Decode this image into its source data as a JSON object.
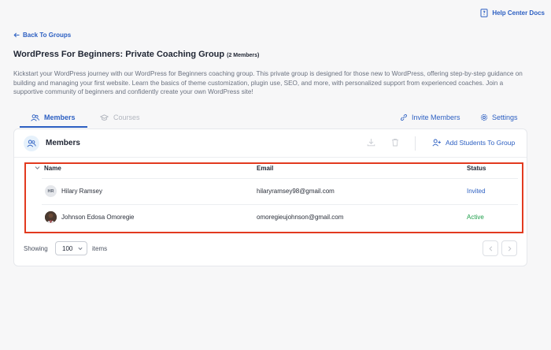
{
  "header": {
    "help_label": "Help Center Docs",
    "back_label": "Back To Groups"
  },
  "group": {
    "title": "WordPress For Beginners: Private Coaching Group",
    "member_count": "(2 Members)",
    "description": "Kickstart your WordPress journey with our WordPress for Beginners coaching group. This private group is designed for those new to WordPress, offering step-by-step guidance on building and managing your first website. Learn the basics of theme customization, plugin use, SEO, and more, with personalized support from experienced coaches. Join a supportive community of beginners and confidently create your own WordPress site!"
  },
  "tabs": [
    {
      "label": "Members",
      "active": true
    },
    {
      "label": "Courses",
      "active": false
    }
  ],
  "tab_actions": {
    "invite_label": "Invite Members",
    "settings_label": "Settings"
  },
  "members_card": {
    "title": "Members",
    "add_label": "Add Students To Group",
    "columns": {
      "name": "Name",
      "email": "Email",
      "status": "Status"
    },
    "rows": [
      {
        "initials": "HR",
        "name": "Hilary Ramsey",
        "email": "hilaryramsey98@gmail.com",
        "status": "Invited",
        "status_color": "#2c5fc2"
      },
      {
        "initials": "",
        "name": "Johnson Edosa Omoregie",
        "email": "omoregieujohnson@gmail.com",
        "status": "Active",
        "status_color": "#1e9e4a"
      }
    ]
  },
  "pagination": {
    "showing_label": "Showing",
    "page_size": "100",
    "items_label": "items"
  },
  "colors": {
    "accent": "#2c5fc2",
    "highlight": "#e23a1f"
  }
}
